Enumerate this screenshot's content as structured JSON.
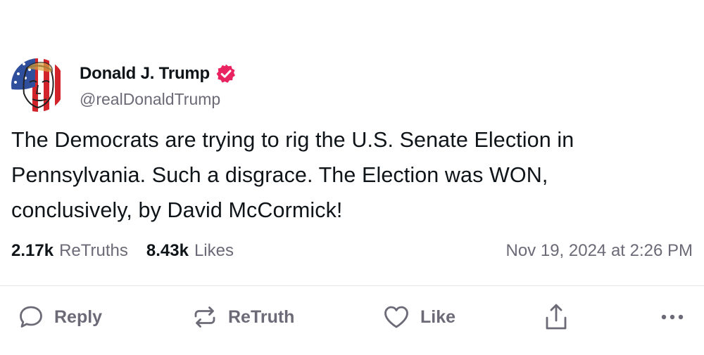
{
  "author": {
    "display_name": "Donald J. Trump",
    "handle": "@realDonaldTrump",
    "verified_color": "#e8235f"
  },
  "post": {
    "text": "The Democrats are trying to rig the U.S. Senate Election in Pennsylvania. Such a disgrace. The Election was WON, conclusively, by David McCormick!",
    "retruths_count": "2.17k",
    "retruths_label": "ReTruths",
    "likes_count": "8.43k",
    "likes_label": "Likes",
    "timestamp": "Nov 19, 2024 at 2:26 PM"
  },
  "actions": {
    "reply_label": "Reply",
    "retruth_label": "ReTruth",
    "like_label": "Like"
  },
  "icons": {
    "reply": "speech-bubble-icon",
    "retruth": "repost-arrows-icon",
    "like": "heart-icon",
    "share": "share-upload-icon",
    "more": "more-dots-icon",
    "verified": "verified-badge-icon"
  },
  "colors": {
    "text": "#0f1419",
    "secondary": "#6b6a76",
    "divider": "#e6e6ea",
    "verified": "#e8235f"
  }
}
